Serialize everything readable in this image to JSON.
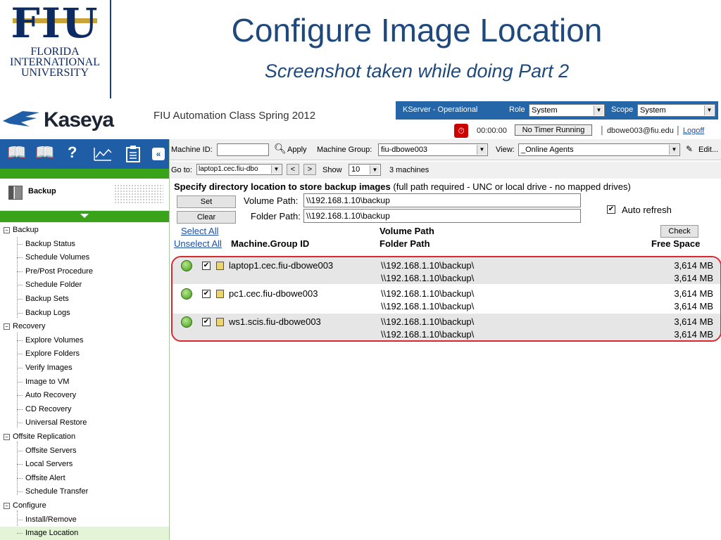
{
  "slide": {
    "logo_mark": "FIU",
    "logo_line1": "FLORIDA",
    "logo_line2": "INTERNATIONAL",
    "logo_line3": "UNIVERSITY",
    "title": "Configure Image Location",
    "subtitle": "Screenshot taken while doing Part 2"
  },
  "app": {
    "brand": "Kaseya",
    "class_title": "FIU Automation Class Spring 2012",
    "kserver_status": "KServer - Operational",
    "role_label": "Role",
    "role_value": "System",
    "scope_label": "Scope",
    "scope_value": "System",
    "timer": "00:00:00",
    "no_timer": "No Timer Running",
    "user": "dbowe003@fiu.edu",
    "logoff": "Logoff"
  },
  "nav": {
    "module": "Backup",
    "tree": [
      {
        "label": "Backup",
        "type": "group"
      },
      {
        "label": "Backup Status",
        "type": "child"
      },
      {
        "label": "Schedule Volumes",
        "type": "child"
      },
      {
        "label": "Pre/Post Procedure",
        "type": "child"
      },
      {
        "label": "Schedule Folder",
        "type": "child"
      },
      {
        "label": "Backup Sets",
        "type": "child"
      },
      {
        "label": "Backup Logs",
        "type": "child"
      },
      {
        "label": "Recovery",
        "type": "group"
      },
      {
        "label": "Explore Volumes",
        "type": "child"
      },
      {
        "label": "Explore Folders",
        "type": "child"
      },
      {
        "label": "Verify Images",
        "type": "child"
      },
      {
        "label": "Image to VM",
        "type": "child"
      },
      {
        "label": "Auto Recovery",
        "type": "child"
      },
      {
        "label": "CD Recovery",
        "type": "child"
      },
      {
        "label": "Universal Restore",
        "type": "child"
      },
      {
        "label": "Offsite Replication",
        "type": "group"
      },
      {
        "label": "Offsite Servers",
        "type": "child"
      },
      {
        "label": "Local Servers",
        "type": "child"
      },
      {
        "label": "Offsite Alert",
        "type": "child"
      },
      {
        "label": "Schedule Transfer",
        "type": "child"
      },
      {
        "label": "Configure",
        "type": "group"
      },
      {
        "label": "Install/Remove",
        "type": "child"
      },
      {
        "label": "Image Location",
        "type": "child",
        "active": true
      }
    ]
  },
  "filter": {
    "machine_id_label": "Machine ID:",
    "machine_id_value": "",
    "apply": "Apply",
    "group_label": "Machine Group:",
    "group_value": "fiu-dbowe003",
    "view_label": "View:",
    "view_value": "_Online Agents",
    "edit": "Edit...",
    "goto_label": "Go to:",
    "goto_value": "laptop1.cec.fiu-dbo",
    "show_label": "Show",
    "show_value": "10",
    "machine_count": "3 machines"
  },
  "form": {
    "spec_bold": "Specify directory location to store backup images",
    "spec_normal": " (full path required - UNC or local drive - no mapped drives)",
    "set_button": "Set",
    "clear_button": "Clear",
    "volume_path_label": "Volume Path:",
    "volume_path_value": "\\\\192.168.1.10\\backup",
    "folder_path_label": "Folder Path:",
    "folder_path_value": "\\\\192.168.1.10\\backup",
    "auto_refresh": "Auto refresh",
    "select_all": "Select All",
    "unselect_all": "Unselect All",
    "machine_group_id": "Machine.Group ID",
    "volume_path_col": "Volume Path",
    "folder_path_col": "Folder Path",
    "check_button": "Check",
    "free_space": "Free Space"
  },
  "rows": [
    {
      "machine": "laptop1.cec.fiu-dbowe003",
      "volume": "\\\\192.168.1.10\\backup\\",
      "folder": "\\\\192.168.1.10\\backup\\",
      "free1": "3,614 MB",
      "free2": "3,614 MB"
    },
    {
      "machine": "pc1.cec.fiu-dbowe003",
      "volume": "\\\\192.168.1.10\\backup\\",
      "folder": "\\\\192.168.1.10\\backup\\",
      "free1": "3,614 MB",
      "free2": "3,614 MB"
    },
    {
      "machine": "ws1.scis.fiu-dbowe003",
      "volume": "\\\\192.168.1.10\\backup\\",
      "folder": "\\\\192.168.1.10\\backup\\",
      "free1": "3,614 MB",
      "free2": "3,614 MB"
    }
  ]
}
